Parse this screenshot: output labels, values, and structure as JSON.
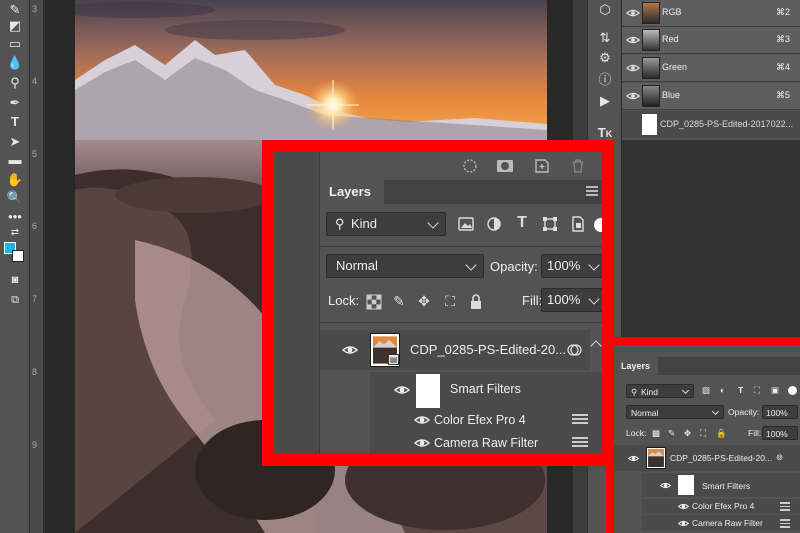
{
  "toolbar": {
    "tools": [
      "pencil-tool",
      "eraser-tool",
      "gradient-tool",
      "blur-tool",
      "dodge-tool",
      "pen-tool",
      "type-tool",
      "path-selection-tool",
      "rectangle-tool",
      "hand-tool",
      "zoom-tool",
      "more-tools"
    ],
    "colors": {
      "foreground": "#16b5e6",
      "background": "#ffffff"
    }
  },
  "ruler": {
    "numbers": [
      "3",
      "4",
      "5",
      "6",
      "7",
      "8",
      "9"
    ]
  },
  "channels": {
    "rows": [
      {
        "name": "RGB",
        "shortcut": "⌘2"
      },
      {
        "name": "Red",
        "shortcut": "⌘3"
      },
      {
        "name": "Green",
        "shortcut": "⌘4"
      },
      {
        "name": "Blue",
        "shortcut": "⌘5"
      }
    ],
    "mask_name": "CDP_0285-PS-Edited-2017022..."
  },
  "layers_panel": {
    "tab_label": "Layers",
    "filter_kind": "Kind",
    "blend_mode": "Normal",
    "opacity_label": "Opacity:",
    "opacity_value": "100%",
    "lock_label": "Lock:",
    "fill_label": "Fill:",
    "fill_value": "100%",
    "layer_name": "CDP_0285-PS-Edited-20...",
    "smart_filters_label": "Smart Filters",
    "filters": [
      "Color Efex Pro 4",
      "Camera Raw Filter"
    ]
  },
  "small_layers_panel": {
    "tab_label": "Layers",
    "filter_kind": "Kind",
    "blend_mode": "Normal",
    "opacity_label": "Opacity:",
    "opacity_value": "100%",
    "lock_label": "Lock:",
    "fill_label": "Fill:",
    "fill_value": "100%",
    "layer_name": "CDP_0285-PS-Edited-20...",
    "smart_filters_label": "Smart Filters",
    "filters": [
      "Color Efex Pro 4",
      "Camera Raw Filter"
    ]
  },
  "colors": {
    "callout_red": "#ff0000",
    "panel_bg": "#535353",
    "selection_blue": "#16b5e6"
  }
}
